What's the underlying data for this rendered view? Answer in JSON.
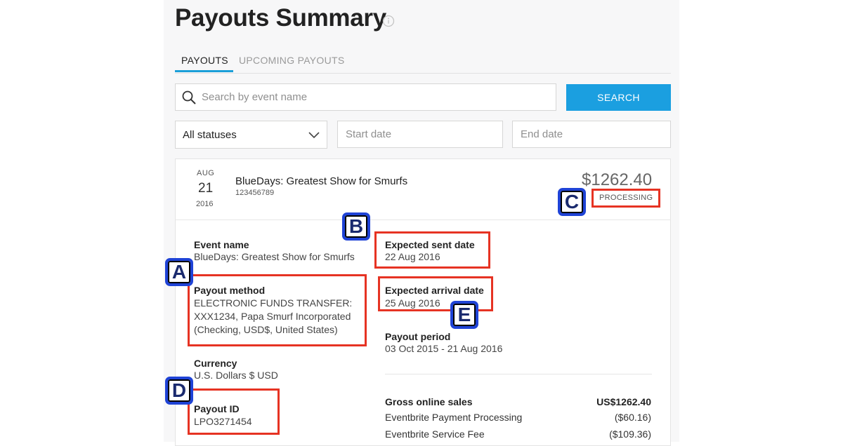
{
  "header": {
    "title": "Payouts Summary",
    "info_icon": "info-circle-icon"
  },
  "tabs": [
    {
      "label": "PAYOUTS",
      "active": true
    },
    {
      "label": "UPCOMING PAYOUTS",
      "active": false
    }
  ],
  "filters": {
    "search_placeholder": "Search by event name",
    "search_button": "SEARCH",
    "status_value": "All statuses",
    "start_date_placeholder": "Start date",
    "end_date_placeholder": "End date"
  },
  "payout": {
    "month": "AUG",
    "day": "21",
    "year": "2016",
    "event_title": "BlueDays: Greatest Show for Smurfs",
    "event_number": "123456789",
    "amount": "$1262.40",
    "status": "PROCESSING",
    "details": {
      "event_name_label": "Event name",
      "event_name_value": "BlueDays: Greatest Show for Smurfs",
      "payout_method_label": "Payout method",
      "payout_method_lines": [
        "ELECTRONIC FUNDS TRANSFER:",
        "XXX1234, Papa Smurf Incorporated",
        "(Checking, USD$, United States)"
      ],
      "currency_label": "Currency",
      "currency_value": "U.S. Dollars $ USD",
      "payout_id_label": "Payout ID",
      "payout_id_value": "LPO3271454",
      "expected_sent_label": "Expected sent date",
      "expected_sent_value": "22 Aug 2016",
      "expected_arrival_label": "Expected arrival date",
      "expected_arrival_value": "25 Aug 2016",
      "payout_period_label": "Payout period",
      "payout_period_value": "03 Oct 2015 - 21 Aug 2016"
    },
    "summary": [
      {
        "label": "Gross online sales",
        "value": "US$1262.40"
      },
      {
        "label": "Eventbrite Payment Processing",
        "value": "($60.16)"
      },
      {
        "label": "Eventbrite Service Fee",
        "value": "($109.36)"
      }
    ]
  },
  "annotations": {
    "a": "A",
    "b": "B",
    "c": "C",
    "d": "D",
    "e": "E"
  },
  "colors": {
    "accent": "#1b9fe0",
    "annotation_box": "#e63323",
    "marker_border": "#1f43d6"
  }
}
